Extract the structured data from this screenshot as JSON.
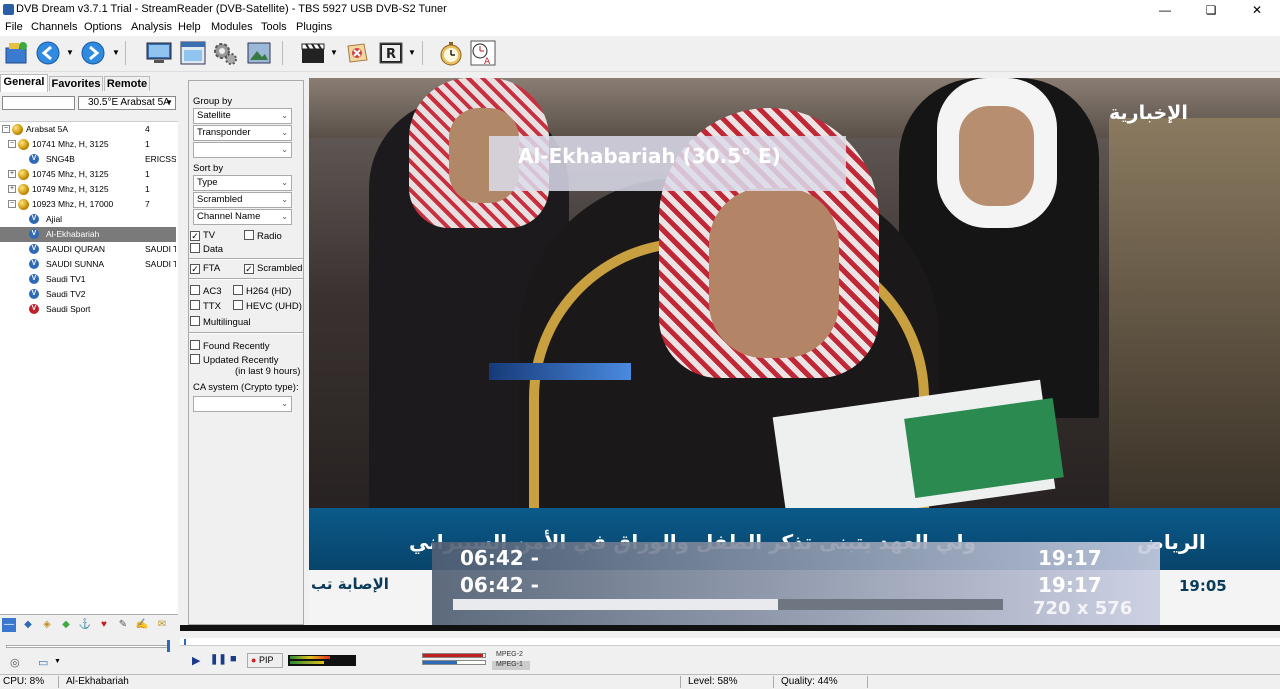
{
  "window": {
    "title": "DVB Dream v3.7.1 Trial - StreamReader (DVB-Satellite)  -  TBS 5927 USB DVB-S2 Tuner",
    "minimize": "—",
    "maximize": "❏",
    "close": "✕"
  },
  "menu": [
    "File",
    "Channels",
    "Options",
    "Analysis",
    "Help",
    "Modules",
    "Tools",
    "Plugins"
  ],
  "tabs": [
    "General",
    "Favorites",
    "Remote"
  ],
  "satellite_select": "30.5°E Arabsat 5A",
  "tree": [
    {
      "name": "Arabsat 5A",
      "count": "4",
      "kind": "satellite",
      "expander": "−"
    },
    {
      "name": "10741 Mhz, H, 3125",
      "count": "1",
      "kind": "transponder",
      "expander": "−"
    },
    {
      "name": "SNG4B",
      "count": "ERICSS",
      "kind": "channel-blue"
    },
    {
      "name": "10745 Mhz, H, 3125",
      "count": "1",
      "kind": "transponder",
      "expander": "+"
    },
    {
      "name": "10749 Mhz, H, 3125",
      "count": "1",
      "kind": "transponder",
      "expander": "+"
    },
    {
      "name": "10923 Mhz, H, 17000",
      "count": "7",
      "kind": "transponder",
      "expander": "−"
    },
    {
      "name": "Ajial",
      "count": "",
      "kind": "channel-blue"
    },
    {
      "name": "Al-Ekhabariah",
      "count": "",
      "kind": "channel-blue",
      "selected": true
    },
    {
      "name": "SAUDI QURAN",
      "count": "SAUDI T",
      "kind": "channel-blue"
    },
    {
      "name": "SAUDI SUNNA",
      "count": "SAUDI T",
      "kind": "channel-blue"
    },
    {
      "name": "Saudi TV1",
      "count": "",
      "kind": "channel-blue"
    },
    {
      "name": "Saudi TV2",
      "count": "",
      "kind": "channel-blue"
    },
    {
      "name": "Saudi Sport",
      "count": "",
      "kind": "channel-red"
    }
  ],
  "filters": {
    "group_by_label": "Group by",
    "group_by": [
      "Satellite",
      "Transponder",
      ""
    ],
    "sort_by_label": "Sort by",
    "sort_by": [
      "Type",
      "Scrambled",
      "Channel Name"
    ],
    "tv": {
      "label": "TV",
      "checked": true
    },
    "radio": {
      "label": "Radio",
      "checked": false
    },
    "data": {
      "label": "Data",
      "checked": false
    },
    "fta": {
      "label": "FTA",
      "checked": true
    },
    "scrambled": {
      "label": "Scrambled",
      "checked": true
    },
    "ac3": {
      "label": "AC3",
      "checked": false
    },
    "h264": {
      "label": "H264 (HD)",
      "checked": false
    },
    "ttx": {
      "label": "TTX",
      "checked": false
    },
    "hevc": {
      "label": "HEVC (UHD)",
      "checked": false
    },
    "multilingual": {
      "label": "Multilingual",
      "checked": false
    },
    "found_recently": {
      "label": "Found Recently",
      "checked": false
    },
    "updated_recently": {
      "label": "Updated Recently",
      "checked": false
    },
    "updated_note": "(in last 9 hours)",
    "ca_system_label": "CA system (Crypto type):",
    "ca_system_value": ""
  },
  "osd": {
    "channel_title": "Al-Ekhabariah (30.5° E)",
    "now_start": "06:42 -",
    "next_start": "06:42 -",
    "now_end": "19:17",
    "next_end": "19:17",
    "resolution": "720 x 576",
    "progress": 0.59
  },
  "broadcast": {
    "logo": "الإخبارية",
    "ticker_top": "ولي العهد يتبنى تذكر الطفل والوراق في الأمن السيبراني",
    "ticker_city": "الرياض",
    "ticker_bottom": "الإصابة تب",
    "clock": "19:05"
  },
  "player": {
    "pip_label": "PIP",
    "codec_video": "MPEG-2",
    "codec_audio": "MPEG-1"
  },
  "status": {
    "cpu": "CPU: 8%",
    "channel": "Al-Ekhabariah",
    "level": "Level: 58%",
    "quality": "Quality: 44%",
    "level_value": 0.58,
    "quality_value": 0.44
  },
  "colors": {
    "accent": "#2f6ab5",
    "selection": "#7a7a7a",
    "osd_bar": "#3a78d0"
  }
}
